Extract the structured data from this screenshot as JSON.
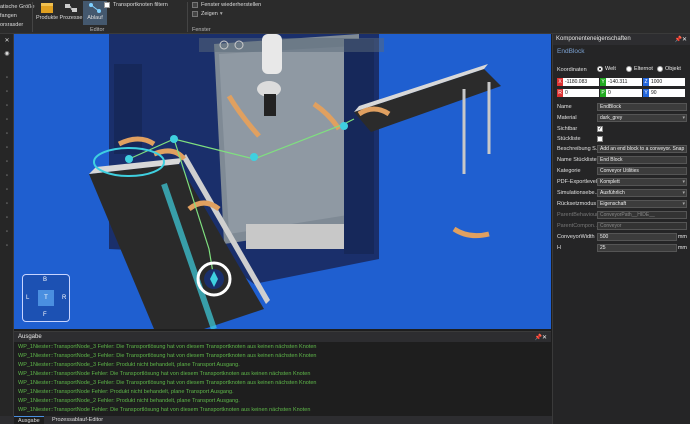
{
  "ribbon": {
    "left_texts": [
      "atische Größe",
      "fangen",
      "orsrasder"
    ],
    "buttons": [
      {
        "label": "Produkte",
        "icon": "products-icon"
      },
      {
        "label": "Prozesse",
        "icon": "processes-icon"
      },
      {
        "label": "Ablauf",
        "icon": "flow-icon"
      }
    ],
    "editor_label": "Editor",
    "transport_checkbox": "Transportknoten filtern",
    "window_restore": "Fenster wiederherstellen",
    "show_label": "Zeigen",
    "window_group_label": "Fenster"
  },
  "properties": {
    "title": "Komponenteneigenschaften",
    "component_name": "EndBlock",
    "coordinates_label": "Koordinaten",
    "coord_modes": [
      "Welt",
      "Elternot",
      "Objekt"
    ],
    "coord_selected": "Welt",
    "coords": {
      "x": "-1180.083",
      "y": "-140.311",
      "z": "1000",
      "rx": "0",
      "ry": "0",
      "rz": "90"
    },
    "rows": [
      {
        "label": "Name",
        "value": "EndBlock",
        "kind": "text"
      },
      {
        "label": "Material",
        "value": "dark_grey",
        "kind": "drop"
      },
      {
        "label": "Sichtbar",
        "value": "",
        "kind": "check-on"
      },
      {
        "label": "Stückliste",
        "value": "",
        "kind": "check-off"
      },
      {
        "label": "Beschreibung S...",
        "value": "Add an end block to a conveyor. Snap",
        "kind": "text"
      },
      {
        "label": "Name Stückliste",
        "value": "End Block",
        "kind": "text"
      },
      {
        "label": "Kategorie",
        "value": "Conveyor Utilities",
        "kind": "text"
      },
      {
        "label": "PDF-Exportlevel",
        "value": "Komplett",
        "kind": "drop"
      },
      {
        "label": "Simulationsebe...",
        "value": "Ausführlich",
        "kind": "drop"
      },
      {
        "label": "Rücksetzmodus",
        "value": "Eigenschaft",
        "kind": "drop"
      },
      {
        "label": "ParentBehaviour",
        "value": "ConveyorPath__HIDE__",
        "kind": "dim"
      },
      {
        "label": "ParentCompon...",
        "value": "Conveyor",
        "kind": "dim"
      },
      {
        "label": "ConveyorWidth",
        "value": "500",
        "kind": "text"
      },
      {
        "label": "H",
        "value": "25",
        "kind": "text"
      }
    ],
    "unit": "mm"
  },
  "output": {
    "title": "Ausgabe",
    "lines": [
      "WP_1Niester::TransportNode_3 Fehler: Die Transportlösung hat von diesem Transportknoten aus keinen nächsten Knoten",
      "WP_1Niester::TransportNode_3 Fehler: Die Transportlösung hat von diesem Transportknoten aus keinen nächsten Knoten",
      "WP_1Niester::TransportNode_3 Fehler: Produkt nicht behandelt, plane Transport Ausgang.",
      "WP_1Niester::TransportNode Fehler: Die Transportlösung hat von diesem Transportknoten aus keinen nächsten Knoten",
      "WP_1Niester::TransportNode_3 Fehler: Die Transportlösung hat von diesem Transportknoten aus keinen nächsten Knoten",
      "WP_1Niester::TransportNode Fehler: Produkt nicht behandelt, plane Transport Ausgang.",
      "WP_1Niester::TransportNode_2 Fehler: Produkt nicht behandelt, plane Transport Ausgang.",
      "WP_1Niester::TransportNode Fehler: Die Transportlösung hat von diesem Transportknoten aus keinen nächsten Knoten"
    ]
  },
  "tabs": [
    "Ausgabe",
    "Prozessablauf-Editor"
  ],
  "viewcube": {
    "top": "B",
    "left": "L",
    "center": "T",
    "right": "R",
    "bottom": "F"
  },
  "colors": {
    "viewport_bg": "#1f5fd0",
    "log_green": "#5fb84a",
    "machine_blue": "#1a2f6b",
    "accent": "#4a8fe0"
  }
}
